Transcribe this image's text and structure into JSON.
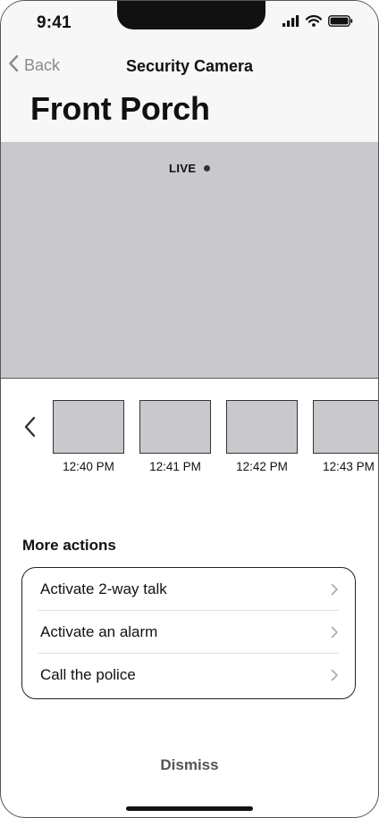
{
  "status_bar": {
    "time": "9:41",
    "icons": [
      "cellular-signal-icon",
      "wifi-icon",
      "battery-icon"
    ]
  },
  "nav": {
    "back_label": "Back",
    "title": "Security Camera"
  },
  "page": {
    "title": "Front Porch"
  },
  "feed": {
    "live_label": "LIVE"
  },
  "thumbnails": [
    {
      "time": "12:40 PM"
    },
    {
      "time": "12:41 PM"
    },
    {
      "time": "12:42 PM"
    },
    {
      "time": "12:43 PM"
    }
  ],
  "more_actions": {
    "label": "More actions",
    "items": [
      {
        "label": "Activate 2-way talk"
      },
      {
        "label": "Activate an alarm"
      },
      {
        "label": "Call the police"
      }
    ]
  },
  "dismiss_label": "Dismiss",
  "colors": {
    "feed_placeholder": "#c9c8cd",
    "header_background": "#f7f7f7",
    "muted_text": "#8a8a8a"
  }
}
